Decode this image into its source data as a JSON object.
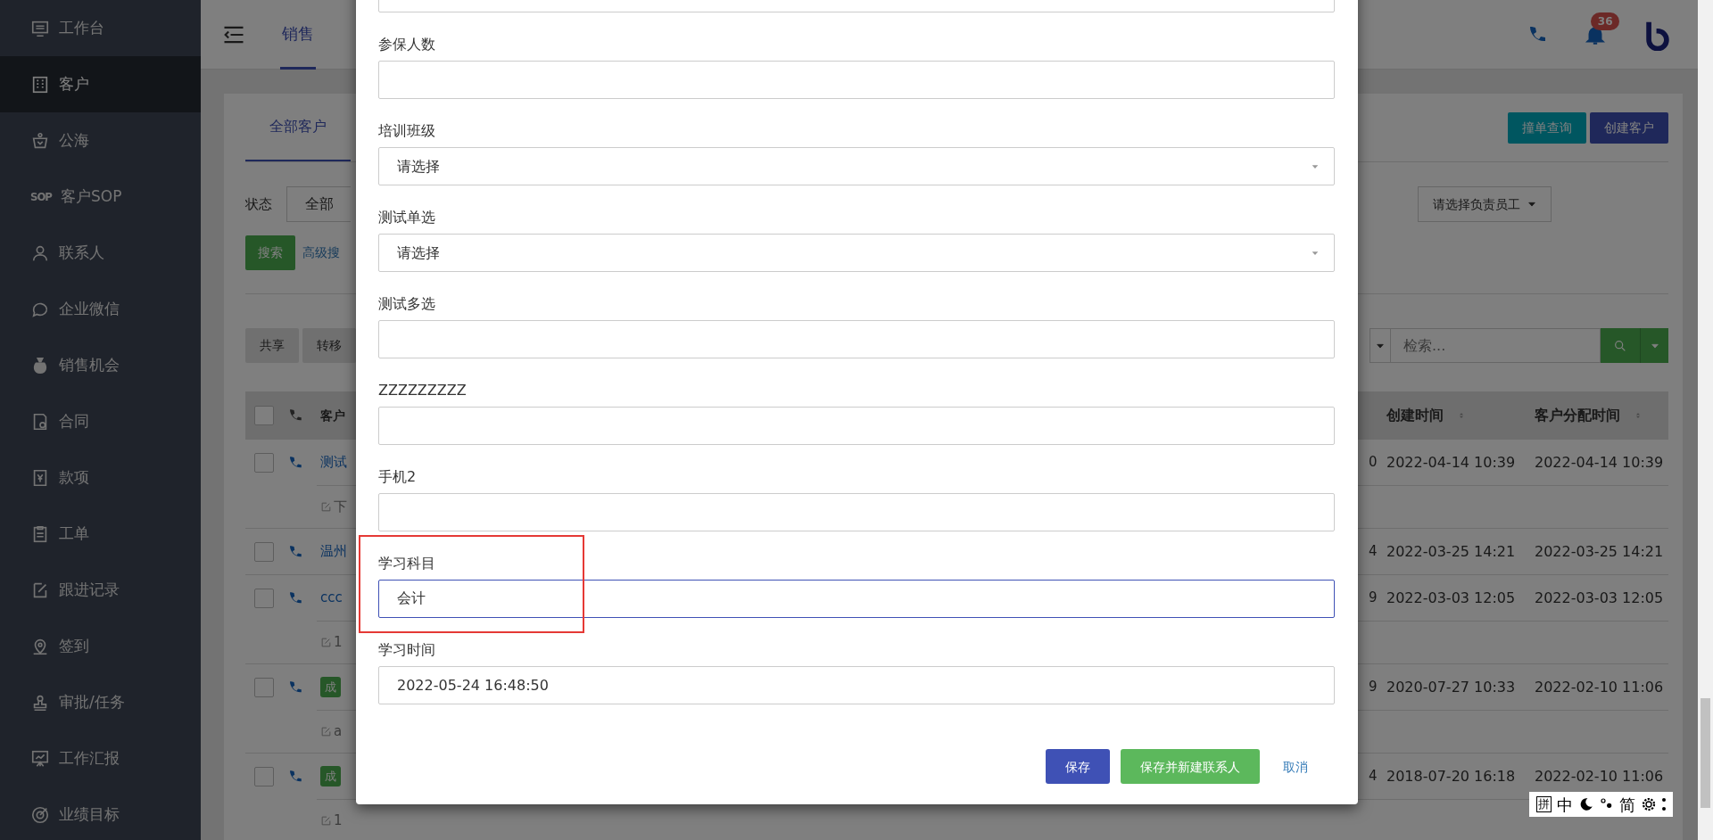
{
  "sidebar": {
    "items": [
      {
        "label": "工作台",
        "selected": false
      },
      {
        "label": "客户",
        "selected": true
      },
      {
        "label": "公海",
        "selected": false
      },
      {
        "label": "客户SOP",
        "icon_text": "SOP",
        "selected": false
      },
      {
        "label": "联系人",
        "selected": false
      },
      {
        "label": "企业微信",
        "selected": false
      },
      {
        "label": "销售机会",
        "selected": false
      },
      {
        "label": "合同",
        "selected": false
      },
      {
        "label": "款项",
        "selected": false
      },
      {
        "label": "工单",
        "selected": false
      },
      {
        "label": "跟进记录",
        "selected": false
      },
      {
        "label": "签到",
        "selected": false
      },
      {
        "label": "审批/任务",
        "selected": false
      },
      {
        "label": "工作汇报",
        "selected": false
      },
      {
        "label": "业绩目标",
        "selected": false
      }
    ]
  },
  "topbar": {
    "tabs": [
      {
        "label": "销售",
        "selected": true
      }
    ],
    "notification_count": "36"
  },
  "card": {
    "tabs": [
      {
        "label": "全部客户",
        "selected": true
      }
    ],
    "header_buttons": [
      {
        "label": "撞单查询",
        "kind": "info"
      },
      {
        "label": "创建客户",
        "kind": "primary"
      }
    ],
    "status_label": "状态",
    "status_value": "全部",
    "staff_placeholder": "请选择负责员工",
    "search_button": "搜索",
    "advanced_search_link": "高级搜",
    "actions": [
      "共享",
      "转移"
    ],
    "search_placeholder": "检索..."
  },
  "table": {
    "columns": [
      "客户",
      "创建时间",
      "客户分配时间"
    ],
    "all_checked": false,
    "rows": [
      {
        "checked": false,
        "kind": "link",
        "name": "测试",
        "column_3": "0",
        "created": "2022-04-14 10:39",
        "assigned": "2022-04-14 10:39",
        "note": "下"
      },
      {
        "checked": false,
        "kind": "link",
        "name": "温州",
        "column_3": "4",
        "created": "2022-03-25 14:21",
        "assigned": "2022-03-25 14:21"
      },
      {
        "checked": false,
        "kind": "link",
        "name": "ccc",
        "column_3": "9",
        "created": "2022-03-03 12:05",
        "assigned": "2022-03-03 12:05",
        "note": "1"
      },
      {
        "checked": false,
        "kind": "badge",
        "name": "成",
        "column_3": "9",
        "created": "2020-07-27 10:33",
        "assigned": "2022-02-10 11:06",
        "note": "a"
      },
      {
        "checked": false,
        "kind": "badge",
        "name": "成",
        "column_3": "4",
        "created": "2018-07-20 16:18",
        "assigned": "2022-02-10 11:06",
        "note": "1"
      }
    ]
  },
  "modal": {
    "fields": [
      {
        "kind": "text",
        "focused": false,
        "highlighted": false
      },
      {
        "label": "参保人数",
        "kind": "text",
        "focused": false,
        "highlighted": false
      },
      {
        "label": "培训班级",
        "kind": "select",
        "value": "请选择",
        "focused": false,
        "highlighted": false
      },
      {
        "label": "测试单选",
        "kind": "select",
        "value": "请选择",
        "focused": false,
        "highlighted": false
      },
      {
        "label": "测试多选",
        "kind": "text",
        "focused": false,
        "highlighted": false
      },
      {
        "label": "ZZZZZZZZZ",
        "kind": "text",
        "focused": false,
        "highlighted": false
      },
      {
        "label": "手机2",
        "kind": "text",
        "focused": false,
        "highlighted": false
      },
      {
        "label": "学习科目",
        "kind": "text",
        "value": "会计",
        "focused": true,
        "highlighted": true
      },
      {
        "label": "学习时间",
        "kind": "text",
        "value": "2022-05-24 16:48:50",
        "focused": false,
        "highlighted": false
      }
    ],
    "buttons": [
      {
        "label": "保存",
        "kind": "primary"
      },
      {
        "label": "保存并新建联系人",
        "kind": "success"
      },
      {
        "label": "取消",
        "kind": "link"
      }
    ]
  },
  "ime_toolbar": {
    "mode": "拼",
    "language": "中",
    "charset": "简"
  }
}
